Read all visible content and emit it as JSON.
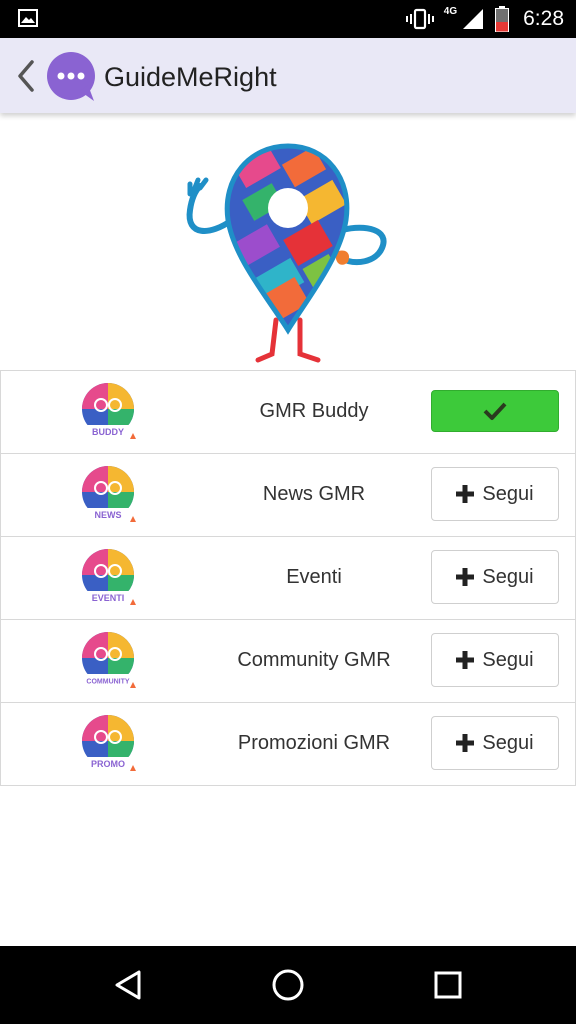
{
  "status_bar": {
    "time": "6:28",
    "network_type": "4G",
    "icons": [
      "gallery-icon",
      "vibrate-icon",
      "signal-icon",
      "battery-icon"
    ]
  },
  "app_bar": {
    "title": "GuideMeRight",
    "back_icon": "back-arrow-icon",
    "logo_icon": "chat-bubble-logo-icon",
    "accent_color": "#8a63d2"
  },
  "channels": [
    {
      "name": "GMR Buddy",
      "badge": "BUDDY",
      "following": true,
      "action_label": ""
    },
    {
      "name": "News GMR",
      "badge": "NEWS",
      "following": false,
      "action_label": "Segui"
    },
    {
      "name": "Eventi",
      "badge": "EVENTI",
      "following": false,
      "action_label": "Segui"
    },
    {
      "name": "Community GMR",
      "badge": "COMMUNITY",
      "following": false,
      "action_label": "Segui"
    },
    {
      "name": "Promozioni GMR",
      "badge": "PROMO",
      "following": false,
      "action_label": "Segui"
    }
  ],
  "colors": {
    "following_button": "#3dca3a",
    "app_bar_bg": "#e9e8f6"
  },
  "nav_bar": {
    "icons": [
      "back-triangle-icon",
      "home-circle-icon",
      "recents-square-icon"
    ]
  }
}
